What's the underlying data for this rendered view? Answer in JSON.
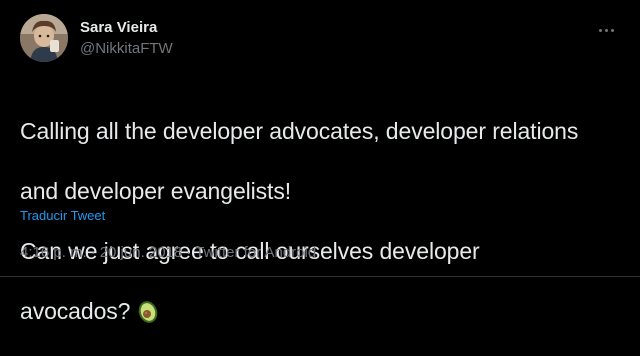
{
  "author": {
    "display_name": "Sara Vieira",
    "handle": "@NikkitaFTW",
    "avatar_icon": "profile-photo"
  },
  "tweet": {
    "lines": [
      "Calling all the developer advocates, developer relations",
      "and developer evangelists!",
      "Can we just agree to call ourselves developer",
      "avocados?"
    ],
    "emoji": "avocado-emoji"
  },
  "translate_label": "Traducir Tweet",
  "meta": {
    "time": "4:16 p. m.",
    "separator": "·",
    "date": "20 jun. 2018",
    "source": "Twitter for Android"
  },
  "colors": {
    "background": "#000000",
    "text": "#e7e9ea",
    "muted": "#71767b",
    "link": "#1d9bf0"
  }
}
